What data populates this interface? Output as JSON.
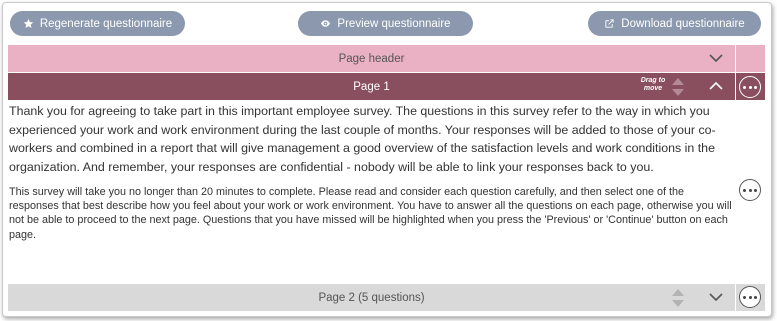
{
  "toolbar": {
    "regenerate_label": "Regenerate questionnaire",
    "regenerate_icon": "star-icon",
    "preview_label": "Preview questionnaire",
    "preview_icon": "eye-icon",
    "download_label": "Download questionnaire",
    "download_icon": "external-link-icon"
  },
  "page_header": {
    "label": "Page header",
    "color": "#eab1c5"
  },
  "page1": {
    "label": "Page 1",
    "drag_hint": "Drag to move",
    "color": "#8a4f5f",
    "paragraph1": "Thank you for agreeing to take part in this important employee survey. The questions in this survey refer to the way in which you experienced your work and work environment during the last couple of months. Your responses will be added to those of your co-workers and combined in a report that will give management a good overview of the satisfaction levels and work conditions in the organization. And remember, your responses are confidential - nobody will be able to link your responses back to you.",
    "paragraph2": "This survey will take you no longer than 20 minutes to complete. Please read and consider each question carefully, and then select one of the responses that best describe how you feel about your work or work environment. You have to answer all the questions on each page, otherwise you will not be able to proceed to the next page. Questions that you have missed will be highlighted when you press the 'Previous' or 'Continue' button on each page."
  },
  "page2": {
    "label": "Page 2 (5 questions)",
    "color": "#d9d9d9"
  },
  "colors": {
    "button_bg": "#8b98ad",
    "button_text": "#ffffff"
  }
}
